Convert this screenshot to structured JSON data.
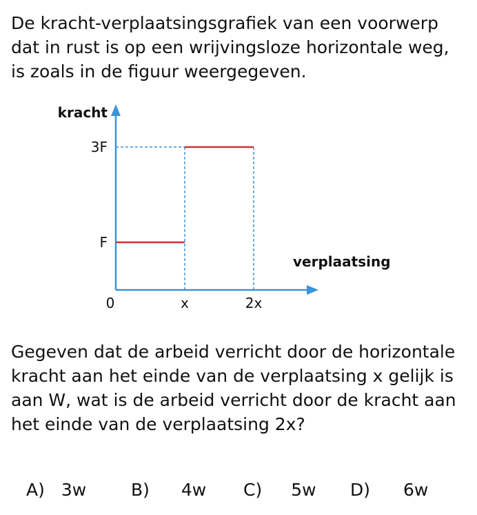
{
  "question": {
    "intro_lines": [
      "De kracht-verplaatsingsgrafiek van een voorwerp",
      "dat in rust is op een wrijvingsloze horizontale weg,",
      "is zoals in de figuur weergegeven."
    ],
    "body_lines": [
      "Gegeven dat de arbeid verricht door de horizontale",
      "kracht aan het einde van de verplaatsing x gelijk is",
      "aan W, wat is de arbeid verricht door de kracht aan",
      "het einde van de verplaatsing 2x?"
    ]
  },
  "figure": {
    "y_axis_label": "kracht",
    "x_axis_label": "verplaatsing",
    "origin_label": "0",
    "colors": {
      "axis": "#3b93d8",
      "guide": "#3b93d8",
      "step": "#cc3333"
    }
  },
  "chart_data": {
    "type": "line",
    "xlabel": "verplaatsing",
    "ylabel": "kracht",
    "x_ticks": [
      "0",
      "x",
      "2x"
    ],
    "y_ticks": [
      "F",
      "3F"
    ],
    "series": [
      {
        "segments": [
          {
            "x": [
              0,
              1
            ],
            "y": [
              1,
              1
            ]
          },
          {
            "x": [
              1,
              2
            ],
            "y": [
              3,
              3
            ]
          }
        ]
      }
    ]
  },
  "answers": [
    {
      "letter": "A)",
      "value": "3w"
    },
    {
      "letter": "B)",
      "value": "4w"
    },
    {
      "letter": "C)",
      "value": "5w"
    },
    {
      "letter": "D)",
      "value": "6w"
    }
  ]
}
